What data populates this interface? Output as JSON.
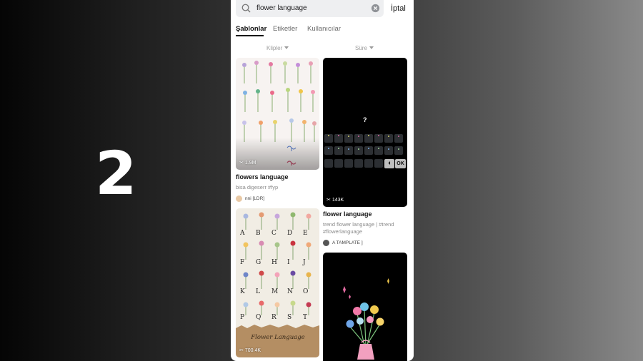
{
  "step": {
    "number": "2"
  },
  "search": {
    "query": "flower language",
    "cancel_label": "İptal"
  },
  "tabs": [
    {
      "label": "Şablonlar",
      "active": true
    },
    {
      "label": "Etiketler",
      "active": false
    },
    {
      "label": "Kullanıcılar",
      "active": false
    }
  ],
  "filters": {
    "clips_label": "Klipler",
    "duration_label": "Süre"
  },
  "templates": [
    {
      "uses": "1.9M",
      "title": "flowers language",
      "description": "bisa digeserr #fyp",
      "author": "nni [LDR]",
      "thumbnail": "floral-grid"
    },
    {
      "uses": "143K",
      "title": "flower language",
      "description": "trend flower language | #trend #flowerlanguage",
      "author": "A TAMPLATE ]",
      "thumbnail": "dark-keyboard",
      "overlay_text": "?",
      "key_labels": [
        "⏴",
        "OK"
      ]
    },
    {
      "uses": "700.4K",
      "title": "",
      "description": "",
      "author": "",
      "thumbnail": "alphabet-flowers",
      "letters": [
        "A",
        "B",
        "C",
        "D",
        "E",
        "F",
        "G",
        "H",
        "I",
        "J",
        "K",
        "L",
        "M",
        "N",
        "O",
        "P",
        "Q",
        "R",
        "S",
        "T"
      ],
      "banner": "Flower  Language"
    },
    {
      "uses": "",
      "title": "",
      "description": "",
      "author": "",
      "thumbnail": "dark-bouquet"
    }
  ],
  "colors": {
    "accent": "#111111",
    "muted": "#8a8a8a",
    "background_phone": "#ffffff"
  }
}
